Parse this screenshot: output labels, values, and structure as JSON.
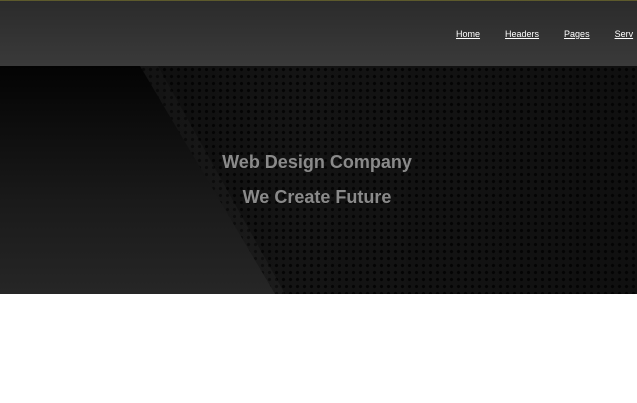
{
  "nav": {
    "items": [
      {
        "label": "Home"
      },
      {
        "label": "Headers"
      },
      {
        "label": "Pages"
      },
      {
        "label": "Serv"
      }
    ]
  },
  "hero": {
    "title": "Web Design Company",
    "subtitle": "We Create Future"
  },
  "colors": {
    "navbar": "#333333",
    "hero_background": "#151515",
    "hero_text": "#8a8a8a",
    "nav_link": "#ffffff",
    "content_background": "#ffffff"
  }
}
